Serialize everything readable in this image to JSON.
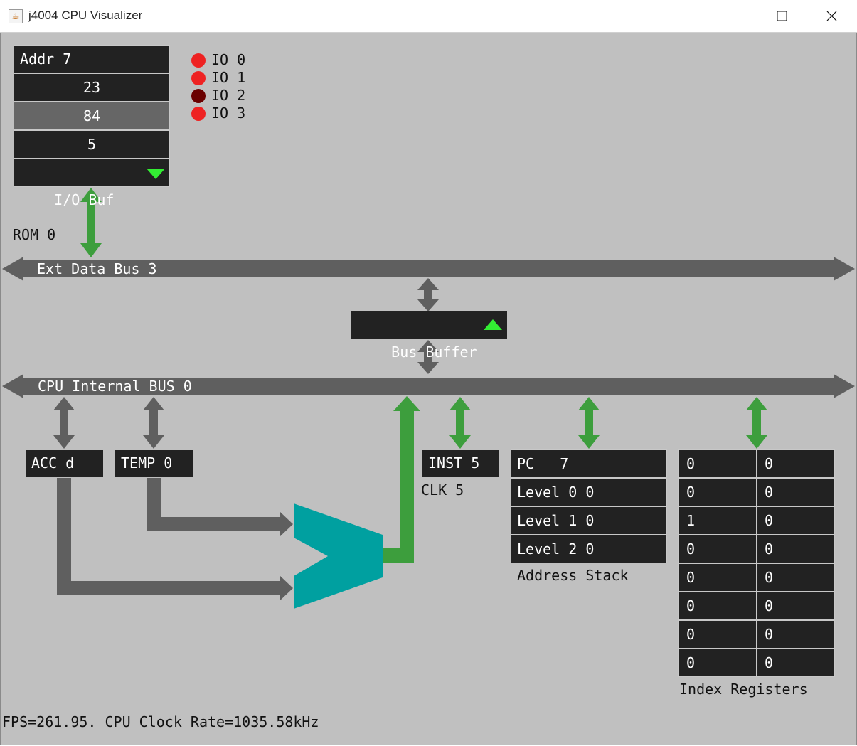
{
  "window": {
    "title": "j4004 CPU Visualizer",
    "icon": "java-cup-icon"
  },
  "colors": {
    "canvas_bg": "#c0c0c0",
    "box_bg": "#222222",
    "bus_gray": "#5f5f5f",
    "active_green": "#3d9e3d",
    "arrow_green": "#33ee33",
    "alu_teal": "#00a0a0",
    "led_on": "#ee2222",
    "led_off": "#6a0000"
  },
  "rom": {
    "addr_label": "Addr 7",
    "values": [
      "23",
      "84",
      "5"
    ],
    "highlighted_index": 1,
    "io_buf_label": "I/O Buf",
    "io_buf_arrow": "down",
    "label": "ROM 0"
  },
  "io_pins": [
    {
      "label": "IO 0",
      "state": "on"
    },
    {
      "label": "IO 1",
      "state": "on"
    },
    {
      "label": "IO 2",
      "state": "off"
    },
    {
      "label": "IO 3",
      "state": "on"
    }
  ],
  "ext_bus": {
    "label": "Ext Data Bus 3"
  },
  "bus_buffer": {
    "label": "Bus Buffer",
    "arrow": "up"
  },
  "internal_bus": {
    "label": "CPU Internal BUS 0"
  },
  "acc": {
    "label": "ACC d"
  },
  "temp": {
    "label": "TEMP 0"
  },
  "inst": {
    "label": "INST 5",
    "clk_label": "CLK 5"
  },
  "address_stack": {
    "rows": [
      "PC   7",
      "Level 0 0",
      "Level 1 0",
      "Level 2 0"
    ],
    "label": "Address Stack"
  },
  "index_registers": {
    "rows": [
      [
        "0",
        "0"
      ],
      [
        "0",
        "0"
      ],
      [
        "1",
        "0"
      ],
      [
        "0",
        "0"
      ],
      [
        "0",
        "0"
      ],
      [
        "0",
        "0"
      ],
      [
        "0",
        "0"
      ],
      [
        "0",
        "0"
      ]
    ],
    "label": "Index Registers"
  },
  "status": {
    "text": "FPS=261.95. CPU Clock Rate=1035.58kHz"
  }
}
